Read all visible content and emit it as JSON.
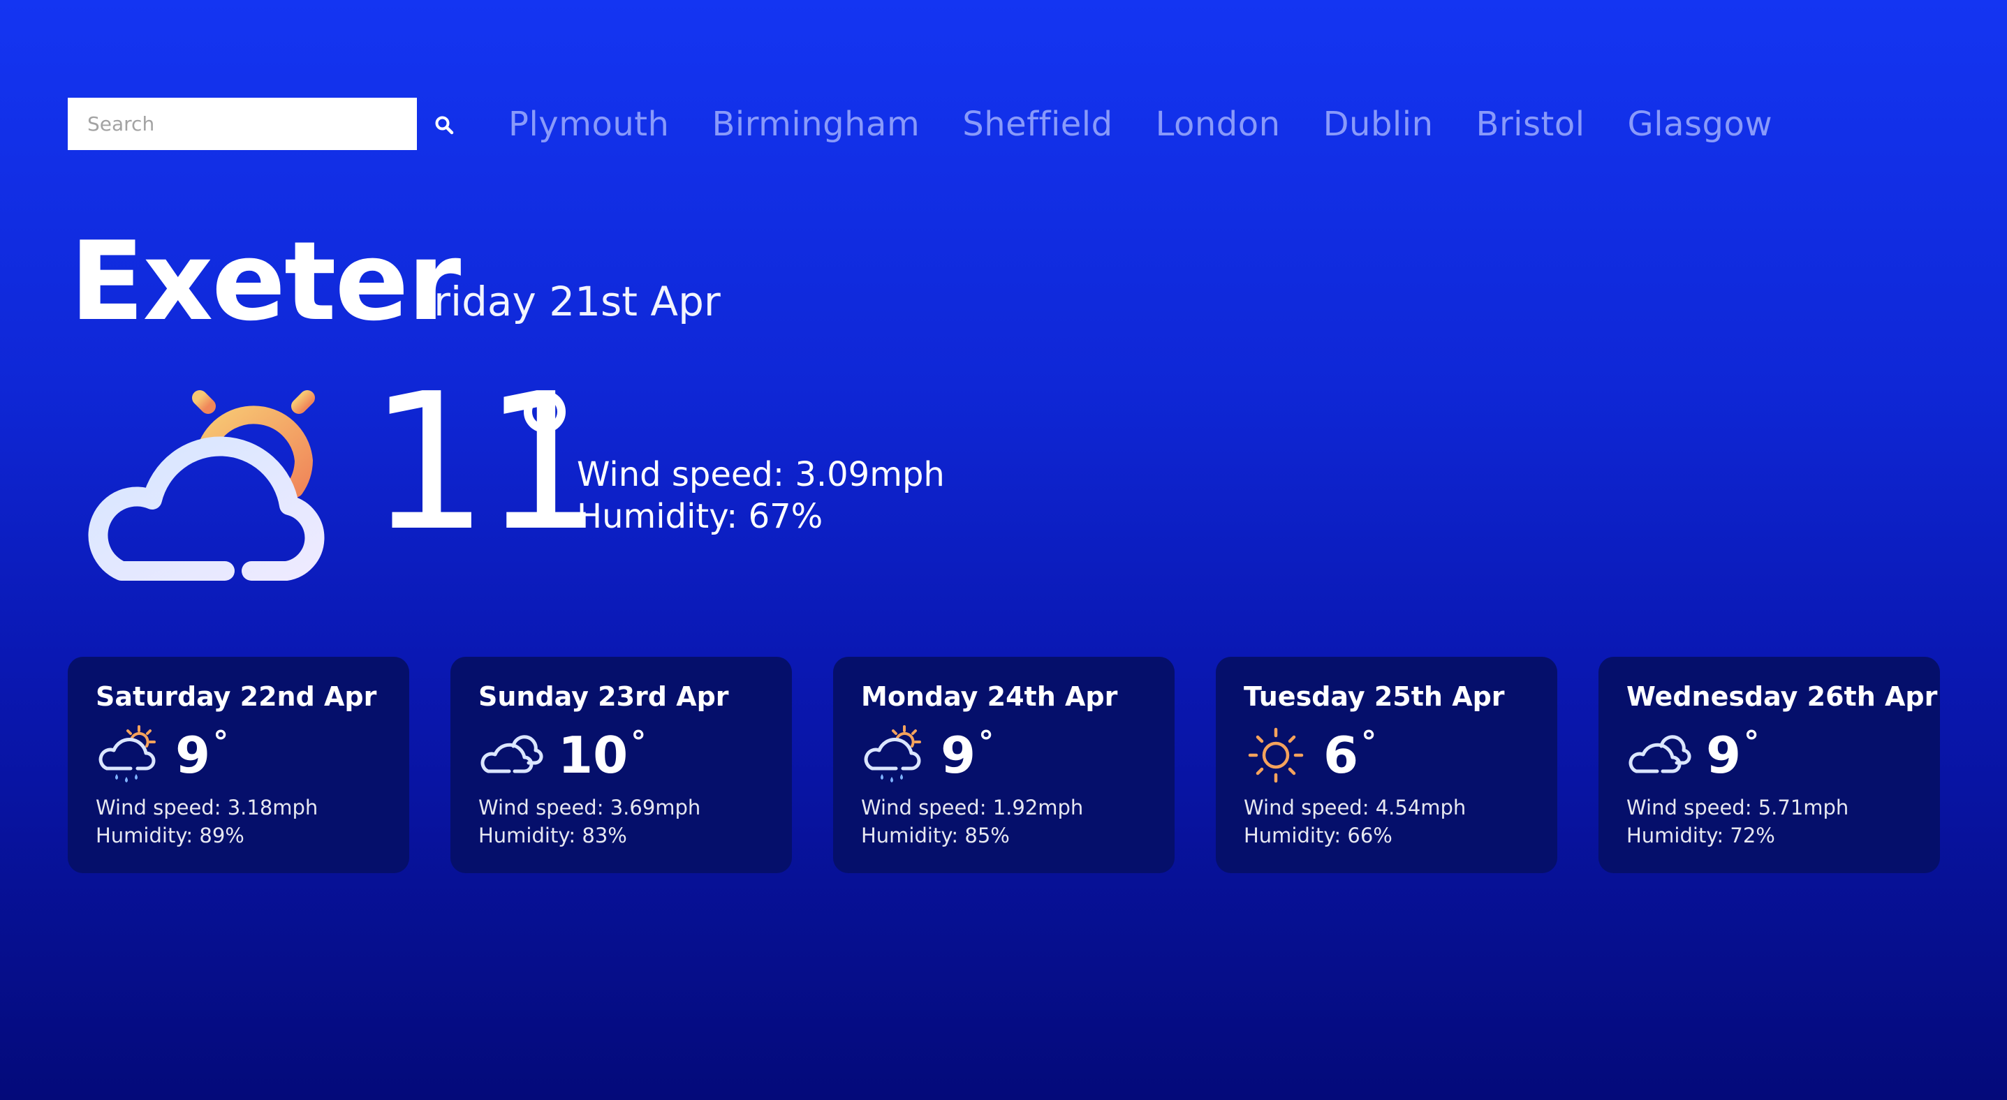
{
  "search": {
    "placeholder": "Search",
    "button_icon": "search-icon"
  },
  "nav": {
    "cities": [
      "Plymouth",
      "Birmingham",
      "Sheffield",
      "London",
      "Dublin",
      "Bristol",
      "Glasgow"
    ]
  },
  "current": {
    "city": "Exeter",
    "date": "Friday 21st Apr",
    "temperature": "11",
    "icon": "partly-cloudy-sun-icon",
    "wind_speed": "Wind speed: 3.09mph",
    "humidity": "Humidity: 67%"
  },
  "forecast": [
    {
      "day": "Saturday 22nd Apr",
      "temperature": "9",
      "icon": "sun-cloud-rain-icon",
      "wind_speed": "Wind speed: 3.18mph",
      "humidity": "Humidity: 89%"
    },
    {
      "day": "Sunday 23rd Apr",
      "temperature": "10",
      "icon": "clouds-icon",
      "wind_speed": "Wind speed: 3.69mph",
      "humidity": "Humidity: 83%"
    },
    {
      "day": "Monday 24th Apr",
      "temperature": "9",
      "icon": "sun-cloud-rain-icon",
      "wind_speed": "Wind speed: 1.92mph",
      "humidity": "Humidity: 85%"
    },
    {
      "day": "Tuesday 25th Apr",
      "temperature": "6",
      "icon": "sun-icon",
      "wind_speed": "Wind speed: 4.54mph",
      "humidity": "Humidity: 66%"
    },
    {
      "day": "Wednesday 26th Apr",
      "temperature": "9",
      "icon": "clouds-icon",
      "wind_speed": "Wind speed: 5.71mph",
      "humidity": "Humidity: 72%"
    }
  ],
  "colors": {
    "background_top": "#1435f2",
    "background_bottom": "#040a7a",
    "card_background": "#050f6b",
    "nav_link": "#a7b5ff",
    "sun_orange": "#f5a35c",
    "cloud_light": "#d8e4ff",
    "rain_blue": "#7fb3ff"
  }
}
